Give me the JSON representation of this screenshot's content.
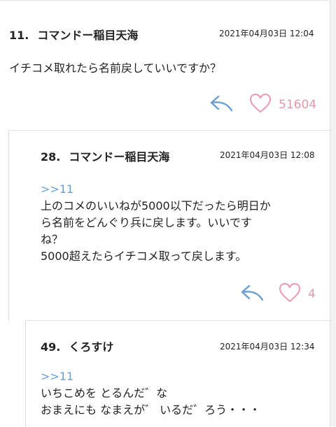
{
  "comments": [
    {
      "number": "11.",
      "name": "コマンドー稲目天海",
      "date": "2021年04月03日 12:04",
      "anchor": "",
      "lines": [
        "イチコメ取れたら名前戻していいですか？"
      ],
      "likes": "51604"
    },
    {
      "number": "28.",
      "name": "コマンドー稲目天海",
      "date": "2021年04月03日 12:08",
      "anchor": ">>11",
      "lines": [
        "上のコメのいいねが5000以下だったら明日か",
        "ら名前をどんぐり兵に戻します。いいです",
        "ね？",
        "5000超えたらイチコメ取って戻します。"
      ],
      "likes": "4"
    },
    {
      "number": "49.",
      "name": "くろすけ",
      "date": "2021年04月03日 12:34",
      "anchor": ">>11",
      "lines": [
        "いちこめを とるんだ゛な",
        "おまえにも なまえが゛ いるだ゛ろう・・・"
      ],
      "likes": ""
    }
  ],
  "colors": {
    "reply_icon": "#6a9ed0",
    "heart_icon": "#e8a0b4",
    "count_text": "#e199aa",
    "anchor_text": "#6a9ed0"
  },
  "icons": {
    "reply": "reply-arrow-icon",
    "like": "heart-outline-icon"
  }
}
